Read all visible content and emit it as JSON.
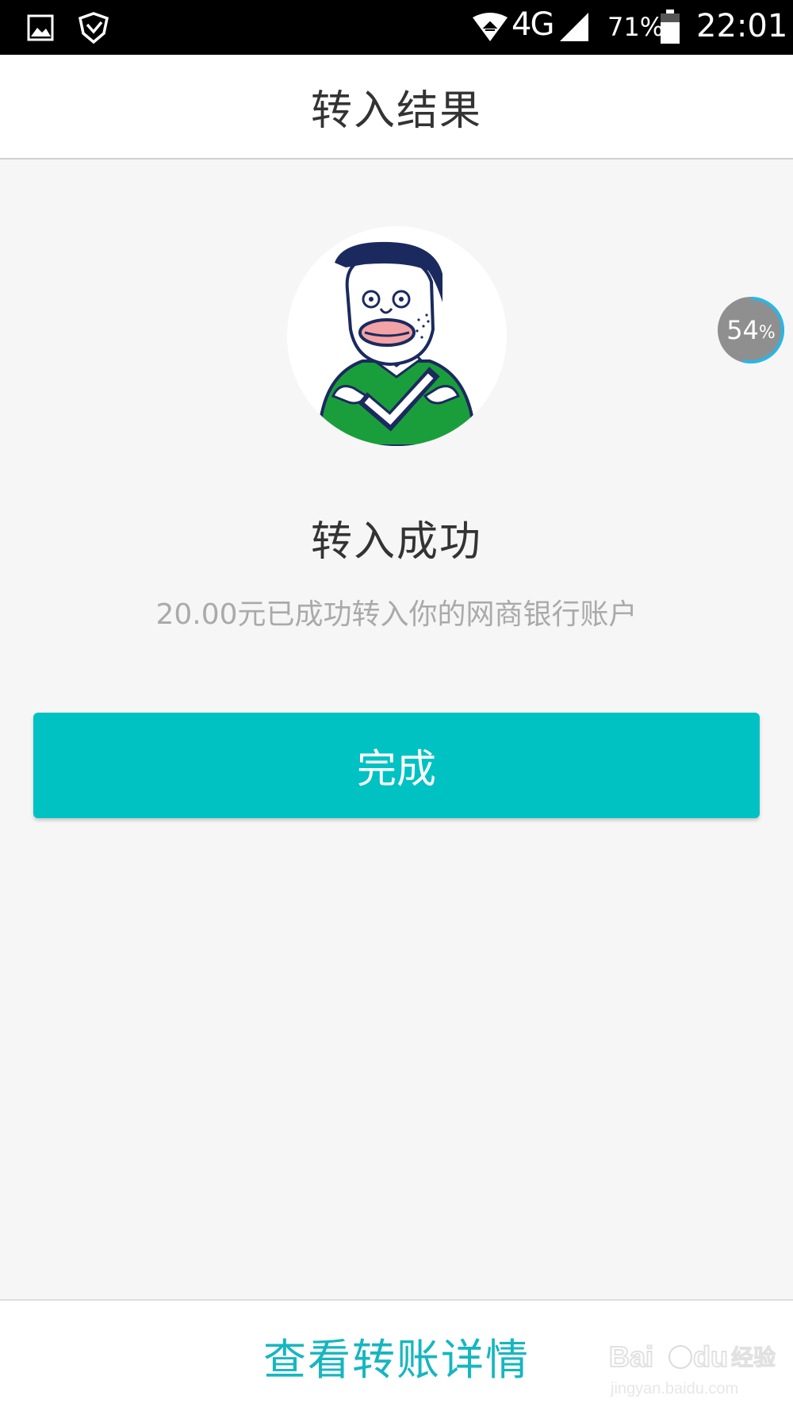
{
  "status_bar": {
    "network_label": "4G",
    "battery_percent": "71%",
    "battery_level": 0.71,
    "time": "22:01",
    "icons": [
      "gallery-icon",
      "shield-icon",
      "wifi-icon",
      "signal-icon",
      "battery-icon"
    ]
  },
  "header": {
    "title": "转入结果"
  },
  "result": {
    "illustration": "success-mascot-illustration",
    "title": "转入成功",
    "description": "20.00元已成功转入你的网商银行账户"
  },
  "actions": {
    "done_label": "完成"
  },
  "footer": {
    "detail_link": "查看转账详情"
  },
  "overlay": {
    "progress_value": "54",
    "progress_unit": "%",
    "progress_fraction": 0.54
  },
  "watermark": {
    "text": "Baidu 经验",
    "url_text": "jingyan.baidu.com"
  },
  "colors": {
    "accent": "#00c2c3",
    "link": "#16b6bf",
    "mascot_shirt": "#1a9e3c",
    "mascot_hair": "#1b2a5e"
  }
}
